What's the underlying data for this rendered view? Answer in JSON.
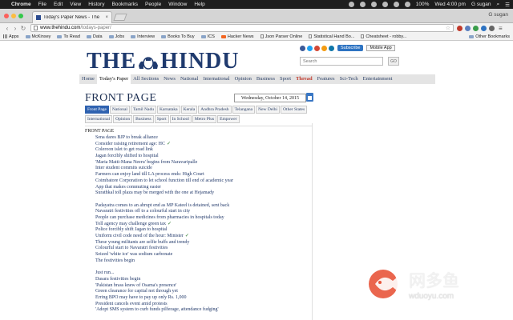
{
  "menubar": {
    "items": [
      "Chrome",
      "File",
      "Edit",
      "View",
      "History",
      "Bookmarks",
      "People",
      "Window",
      "Help"
    ],
    "battery": "100%",
    "clock": "Wed 4:00 pm",
    "user": "G sugan"
  },
  "tab": {
    "title": "Today's Paper News - The",
    "close": "×"
  },
  "profile": "G sugan",
  "address": {
    "host": "www.thehindu.com",
    "path": "/todays-paper/"
  },
  "bookmarks": {
    "items": [
      "Apps",
      "McKinsey",
      "To Read",
      "Data",
      "Jobs",
      "Interview",
      "Books To Buy",
      "ICS",
      "Hacker News",
      "Json Parser Online",
      "Statistical Hand Bo...",
      "Cheatsheet - robby..."
    ],
    "other": "Other Bookmarks"
  },
  "site": {
    "logo_left": "THE",
    "logo_right": "HINDU",
    "subscribe": "Subscribe",
    "mobile_app": "Mobile App",
    "search_placeholder": "Search",
    "go": "GO",
    "nav": [
      "Home",
      "Today's Paper",
      "All Sections",
      "News",
      "National",
      "International",
      "Opinion",
      "Business",
      "Sport",
      "Thread",
      "Features",
      "Sci-Tech",
      "Entertainment"
    ],
    "page_title": "FRONT PAGE",
    "date": "Wednesday, October 14, 2015",
    "sections": [
      "Front Page",
      "National",
      "Tamil Nadu",
      "Karnataka",
      "Kerala",
      "Andhra Pradesh",
      "Telangana",
      "New Delhi",
      "Other States",
      "International",
      "Opinion",
      "Business",
      "Sport",
      "In School",
      "Metro Plus",
      "Empower"
    ],
    "edition_label": "FRONT PAGE",
    "articles": [
      "Sena dares BJP to break alliance",
      "Consider raising retirement age: HC",
      "Coleroon islet to get road link",
      "Jagan forcibly shifted to hospital",
      "'Maria Matti-Mana Neeru' begins from Naravaripalle",
      "Inter student commits suicide",
      "Farmers can enjoy land till LA process ends: High Court",
      "Coimbatore Corporation to let school function till end of academic year",
      "App that makes commuting easier",
      "Surathkal toll plaza may be merged with the one at Hejamady",
      "",
      "Padayatra comes to an abrupt end as MP Kateel is detained, sent back",
      "Navaratri festivities off to a colourful start in city",
      "People can purchase medicines from pharmacies in hospitals today",
      "Toll agency may challenge green tax",
      "Police forcibly shift Jagan to hospital",
      "Uniform civil code need of the hour: Minister",
      "These young militants are selfie buffs and trendy",
      "Colourful start to Navaratri festivities",
      "Seized 'white ice' was sodium carbonate",
      "The festivities begin",
      "",
      "Just run...",
      "Dasara festivities begin",
      "'Pakistan brass knew of Osama's presence'",
      "Green clearance for capital not through yet",
      "Erring BPO may have to pay up only Rs. 1,000",
      "President cancels event amid protests",
      "'Adopt SMS system to curb funds pilferage, attendance fudging'"
    ],
    "checkmark": "✓"
  },
  "watermark": {
    "cn": "网多鱼",
    "en": "wduoyu.com"
  }
}
